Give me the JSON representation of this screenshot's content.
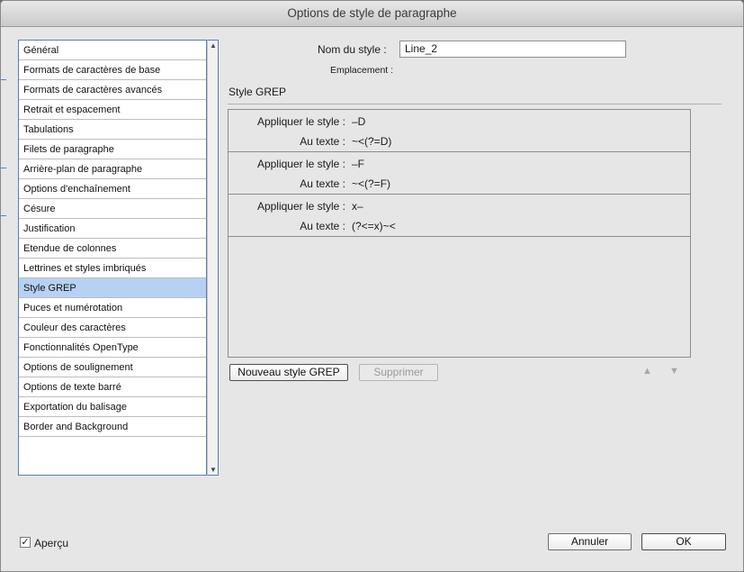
{
  "window": {
    "title": "Options de style de paragraphe"
  },
  "sidebar": {
    "items": [
      {
        "label": "Général",
        "selected": false
      },
      {
        "label": "Formats de caractères de base",
        "selected": false
      },
      {
        "label": "Formats de caractères avancés",
        "selected": false
      },
      {
        "label": "Retrait et espacement",
        "selected": false
      },
      {
        "label": "Tabulations",
        "selected": false
      },
      {
        "label": "Filets de paragraphe",
        "selected": false
      },
      {
        "label": "Arrière-plan de paragraphe",
        "selected": false
      },
      {
        "label": "Options d'enchaînement",
        "selected": false
      },
      {
        "label": "Césure",
        "selected": false
      },
      {
        "label": "Justification",
        "selected": false
      },
      {
        "label": "Etendue de colonnes",
        "selected": false
      },
      {
        "label": "Lettrines et styles imbriqués",
        "selected": false
      },
      {
        "label": "Style GREP",
        "selected": true
      },
      {
        "label": "Puces et numérotation",
        "selected": false
      },
      {
        "label": "Couleur des caractères",
        "selected": false
      },
      {
        "label": "Fonctionnalités OpenType",
        "selected": false
      },
      {
        "label": "Options de soulignement",
        "selected": false
      },
      {
        "label": "Options de texte barré",
        "selected": false
      },
      {
        "label": "Exportation du balisage",
        "selected": false
      },
      {
        "label": "Border and Background",
        "selected": false
      }
    ],
    "scroll_up_icon": "triangle-up",
    "scroll_down_icon": "triangle-down"
  },
  "form": {
    "style_name_label": "Nom du style :",
    "style_name_value": "Line_2",
    "location_label": "Emplacement :",
    "section_title": "Style GREP"
  },
  "grep": {
    "rules": [
      {
        "apply_label": "Appliquer le style :",
        "style": "–D",
        "text_label": "Au texte :",
        "expression": "~<(?=D)"
      },
      {
        "apply_label": "Appliquer le style :",
        "style": "–F",
        "text_label": "Au texte :",
        "expression": "~<(?=F)"
      },
      {
        "apply_label": "Appliquer le style :",
        "style": "x–",
        "text_label": "Au texte :",
        "expression": "(?<=x)~<"
      }
    ],
    "new_button": "Nouveau style GREP",
    "delete_button": "Supprimer",
    "move_up_icon": "▲",
    "move_down_icon": "▼"
  },
  "footer": {
    "preview_label": "Aperçu",
    "preview_checked": true,
    "preview_check_glyph": "✓",
    "cancel_button": "Annuler",
    "ok_button": "OK"
  },
  "colors": {
    "selection": "#b7d1f5",
    "list_border": "#5a7fae"
  }
}
